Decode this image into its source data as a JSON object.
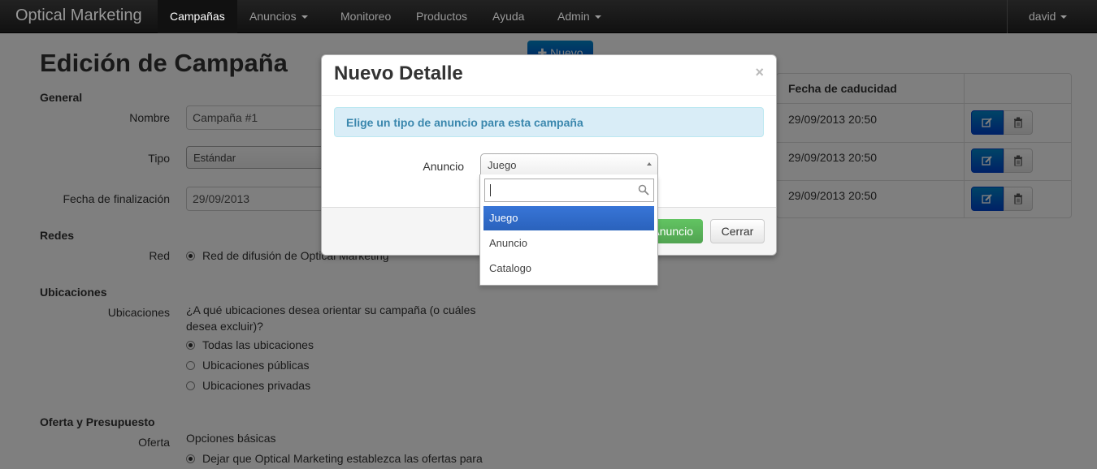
{
  "navbar": {
    "brand": "Optical Marketing",
    "items": [
      {
        "label": "Campañas",
        "active": true,
        "dropdown": false
      },
      {
        "label": "Anuncios",
        "active": false,
        "dropdown": true
      },
      {
        "label": "Monitoreo",
        "active": false,
        "dropdown": false
      },
      {
        "label": "Productos",
        "active": false,
        "dropdown": false
      },
      {
        "label": "Ayuda",
        "active": false,
        "dropdown": false
      },
      {
        "label": "Admin",
        "active": false,
        "dropdown": true
      }
    ],
    "user": "david"
  },
  "page": {
    "title": "Edición de Campaña",
    "new_button": "Nuevo"
  },
  "form": {
    "general_title": "General",
    "name_label": "Nombre",
    "name_value": "Campaña #1",
    "type_label": "Tipo",
    "type_value": "Estándar",
    "end_date_label": "Fecha de finalización",
    "end_date_value": "29/09/2013",
    "networks_title": "Redes",
    "network_label": "Red",
    "network_option": "Red de difusión de Optical Marketing",
    "locations_title": "Ubicaciones",
    "locations_label": "Ubicaciones",
    "locations_question": "¿A qué ubicaciones desea orientar su campaña (o cuáles desea excluir)?",
    "locations_options": [
      {
        "label": "Todas las ubicaciones",
        "selected": true
      },
      {
        "label": "Ubicaciones públicas",
        "selected": false
      },
      {
        "label": "Ubicaciones privadas",
        "selected": false
      }
    ],
    "offer_title": "Oferta y Presupuesto",
    "offer_label": "Oferta",
    "offer_basic": "Opciones básicas",
    "offer_option": "Dejar que Optical Marketing establezca las ofertas para"
  },
  "table": {
    "header_expiry": "Fecha de caducidad",
    "rows": [
      {
        "expiry": "29/09/2013 20:50"
      },
      {
        "expiry": "29/09/2013 20:50"
      },
      {
        "expiry": "29/09/2013 20:50"
      }
    ]
  },
  "modal": {
    "title": "Nuevo Detalle",
    "close_symbol": "×",
    "alert": "Elige un tipo de anuncio para esta campaña",
    "ad_label": "Anuncio",
    "ad_selected": "Juego",
    "save_button": "Anuncio",
    "close_button": "Cerrar",
    "dropdown_options": [
      {
        "label": "Juego",
        "highlighted": true
      },
      {
        "label": "Anuncio",
        "highlighted": false
      },
      {
        "label": "Catalogo",
        "highlighted": false
      }
    ]
  },
  "colors": {
    "primary": "#0055cc",
    "success": "#5bb75b",
    "info_bg": "#d9edf7",
    "info_text": "#3a87ad",
    "highlight": "#3875d7"
  }
}
